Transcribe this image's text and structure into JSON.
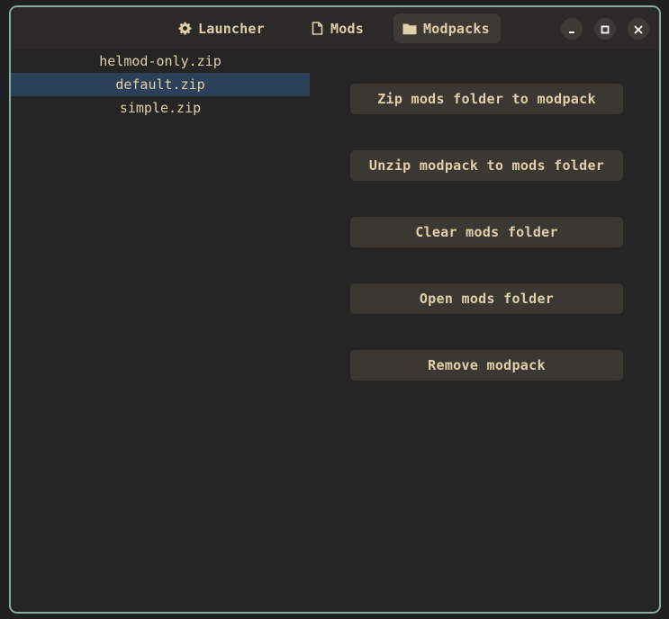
{
  "tabs": [
    {
      "label": "Launcher",
      "icon": "gear-icon",
      "active": false
    },
    {
      "label": "Mods",
      "icon": "file-icon",
      "active": false
    },
    {
      "label": "Modpacks",
      "icon": "folder-icon",
      "active": true
    }
  ],
  "window_controls": {
    "minimize": "minimize-icon",
    "maximize": "maximize-icon",
    "close": "close-icon"
  },
  "modpacks": {
    "items": [
      {
        "label": "helmod-only.zip",
        "selected": false
      },
      {
        "label": "default.zip",
        "selected": true
      },
      {
        "label": "simple.zip",
        "selected": false
      }
    ]
  },
  "actions": {
    "zip": "Zip mods folder to modpack",
    "unzip": "Unzip modpack to mods folder",
    "clear": "Clear mods folder",
    "open": "Open mods folder",
    "remove": "Remove modpack"
  },
  "colors": {
    "accent_border": "#7faf9c",
    "text": "#e0cfa8",
    "selection": "#2c4159",
    "button_bg": "#3b3833"
  }
}
